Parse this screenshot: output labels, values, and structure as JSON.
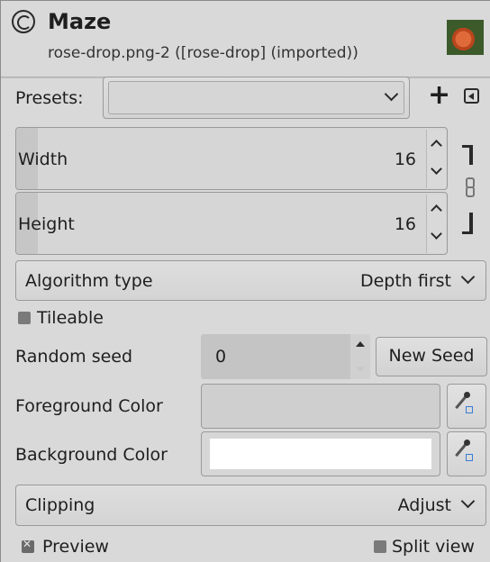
{
  "header": {
    "title": "Maze",
    "subtitle": "rose-drop.png-2 ([rose-drop] (imported))"
  },
  "presets": {
    "label": "Presets:",
    "value": ""
  },
  "width": {
    "label": "Width",
    "value": "16"
  },
  "height": {
    "label": "Height",
    "value": "16"
  },
  "algorithm": {
    "label": "Algorithm type",
    "value": "Depth first"
  },
  "tileable": {
    "label": "Tileable",
    "checked": false
  },
  "random_seed": {
    "label": "Random seed",
    "value": "0",
    "button": "New Seed"
  },
  "foreground": {
    "label": "Foreground Color",
    "color": "#d0d0d0"
  },
  "background": {
    "label": "Background Color",
    "color": "#ffffff"
  },
  "clipping": {
    "label": "Clipping",
    "value": "Adjust"
  },
  "preview": {
    "label": "Preview",
    "checked": true
  },
  "split_view": {
    "label": "Split view",
    "checked": false
  },
  "icons": {
    "header_logo": "gimp-logo-icon",
    "thumbnail": "image-thumbnail",
    "presets_add": "plus-icon",
    "presets_menu": "menu-arrow-icon",
    "chain": "chain-link-icon",
    "color_picker": "color-picker-icon"
  }
}
